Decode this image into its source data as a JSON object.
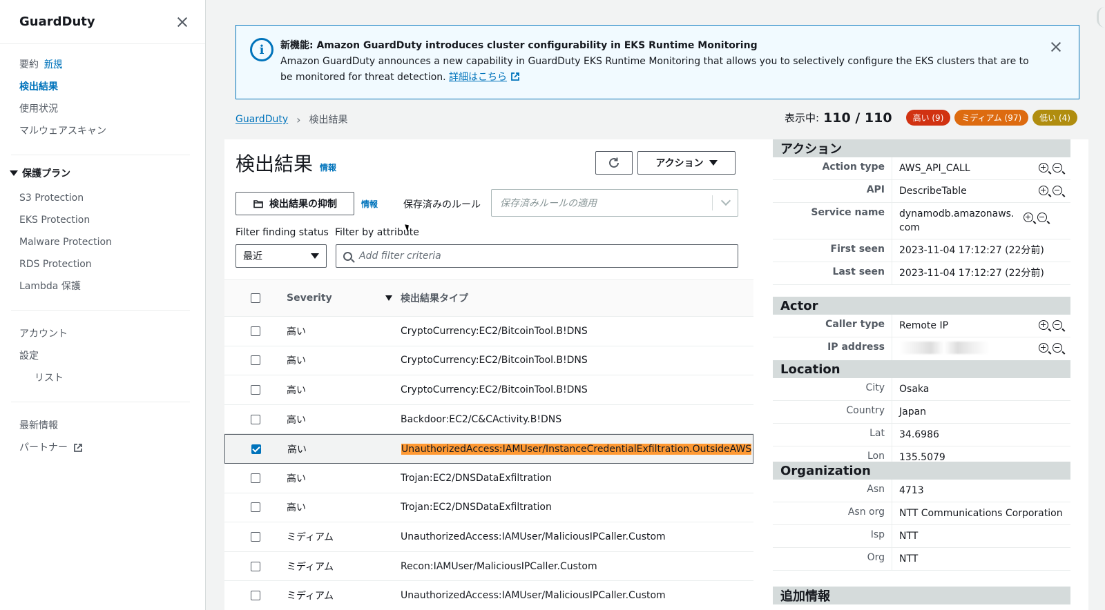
{
  "sidebar": {
    "title": "GuardDuty",
    "items": [
      {
        "label": "要約",
        "badge": "新規"
      },
      {
        "label": "検出結果"
      },
      {
        "label": "使用状況"
      },
      {
        "label": "マルウェアスキャン"
      }
    ],
    "protection_group": "保護プラン",
    "protection_items": [
      {
        "label": "S3 Protection"
      },
      {
        "label": "EKS Protection"
      },
      {
        "label": "Malware Protection"
      },
      {
        "label": "RDS Protection"
      },
      {
        "label": "Lambda 保護"
      }
    ],
    "settings_items": [
      {
        "label": "アカウント"
      },
      {
        "label": "設定"
      },
      {
        "label": "リスト"
      }
    ],
    "footer_items": [
      {
        "label": "最新情報"
      },
      {
        "label": "パートナー"
      }
    ]
  },
  "banner": {
    "title": "新機能: Amazon GuardDuty introduces cluster configurability in EKS Runtime Monitoring",
    "body": "Amazon GuardDuty announces a new capability in GuardDuty EKS Runtime Monitoring that allows you to selectively configure the EKS clusters that are to be monitored for threat detection.",
    "link": "詳細はこちら"
  },
  "breadcrumb": {
    "root": "GuardDuty",
    "current": "検出結果"
  },
  "counts": {
    "label": "表示中:",
    "value": "110 / 110",
    "high": "高い (9)",
    "medium": "ミディアム (97)",
    "low": "低い (4)"
  },
  "main": {
    "title": "検出結果",
    "info": "情報",
    "action_label": "アクション",
    "suppress_label": "検出結果の抑制",
    "saved_rules_label": "保存済みのルール",
    "saved_rules_placeholder": "保存済みルールの適用",
    "filter_status_label": "Filter finding status",
    "filter_attr_label": "Filter by attribute",
    "status_value": "最近",
    "filter_placeholder": "Add filter criteria"
  },
  "table": {
    "headers": {
      "severity": "Severity",
      "type": "検出結果タイプ"
    },
    "rows": [
      {
        "severity": "高い",
        "type": "CryptoCurrency:EC2/BitcoinTool.B!DNS"
      },
      {
        "severity": "高い",
        "type": "CryptoCurrency:EC2/BitcoinTool.B!DNS"
      },
      {
        "severity": "高い",
        "type": "CryptoCurrency:EC2/BitcoinTool.B!DNS"
      },
      {
        "severity": "高い",
        "type": "Backdoor:EC2/C&CActivity.B!DNS"
      },
      {
        "severity": "高い",
        "type": "UnauthorizedAccess:IAMUser/InstanceCredentialExfiltration.OutsideAWS"
      },
      {
        "severity": "高い",
        "type": "Trojan:EC2/DNSDataExfiltration"
      },
      {
        "severity": "高い",
        "type": "Trojan:EC2/DNSDataExfiltration"
      },
      {
        "severity": "ミディアム",
        "type": "UnauthorizedAccess:IAMUser/MaliciousIPCaller.Custom"
      },
      {
        "severity": "ミディアム",
        "type": "Recon:IAMUser/MaliciousIPCaller.Custom"
      },
      {
        "severity": "ミディアム",
        "type": "UnauthorizedAccess:IAMUser/MaliciousIPCaller.Custom"
      }
    ]
  },
  "detail": {
    "action": {
      "title": "アクション",
      "rows": [
        {
          "key": "Action type",
          "value": "AWS_API_CALL"
        },
        {
          "key": "API",
          "value": "DescribeTable"
        },
        {
          "key": "Service name",
          "value": "dynamodb.amazonaws.com"
        },
        {
          "key": "First seen",
          "value": "2023-11-04 17:12:27 (22分前)"
        },
        {
          "key": "Last seen",
          "value": "2023-11-04 17:12:27 (22分前)"
        }
      ]
    },
    "actor": {
      "title": "Actor",
      "rows": [
        {
          "key": "Caller type",
          "value": "Remote IP"
        },
        {
          "key": "IP address",
          "value": ""
        }
      ]
    },
    "location": {
      "title": "Location",
      "rows": [
        {
          "key": "City",
          "value": "Osaka"
        },
        {
          "key": "Country",
          "value": "Japan"
        },
        {
          "key": "Lat",
          "value": "34.6986"
        },
        {
          "key": "Lon",
          "value": "135.5079"
        }
      ]
    },
    "organization": {
      "title": "Organization",
      "rows": [
        {
          "key": "Asn",
          "value": "4713"
        },
        {
          "key": "Asn org",
          "value": "NTT Communications Corporation"
        },
        {
          "key": "Isp",
          "value": "NTT"
        },
        {
          "key": "Org",
          "value": "NTT"
        }
      ]
    },
    "extra": {
      "title": "追加情報"
    }
  }
}
